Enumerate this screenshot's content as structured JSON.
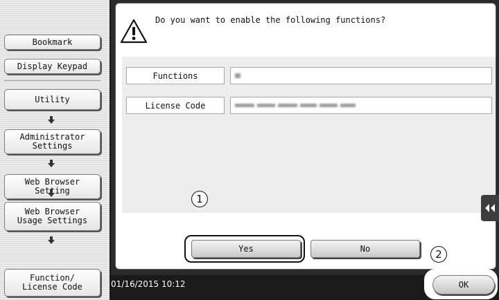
{
  "sidebar": {
    "bookmark_label": "Bookmark",
    "display_keypad_label": "Display Keypad",
    "breadcrumb": [
      {
        "label": "Utility"
      },
      {
        "label": "Administrator\nSettings"
      },
      {
        "label": "Web Browser\nSetting"
      },
      {
        "label": "Web Browser\nUsage Settings"
      },
      {
        "label": "Function/\nLicense Code"
      }
    ],
    "arrow_icon": "down-arrow-icon"
  },
  "dialog": {
    "message": "Do you want to enable the following functions?",
    "icon": "warning-icon",
    "fields": [
      {
        "label": "Functions"
      },
      {
        "label": "License Code"
      }
    ],
    "yes_label": "Yes",
    "no_label": "No"
  },
  "callouts": {
    "first": "1",
    "second": "2"
  },
  "side_tab_icon": "double-left-arrow-icon",
  "status_bar": {
    "datetime": "01/16/2015  10:12",
    "ok_label": "OK"
  },
  "colors": {
    "frame": "#2b2b2b",
    "status_bar": "#1a1a1a",
    "content_bg": "#ededed"
  }
}
